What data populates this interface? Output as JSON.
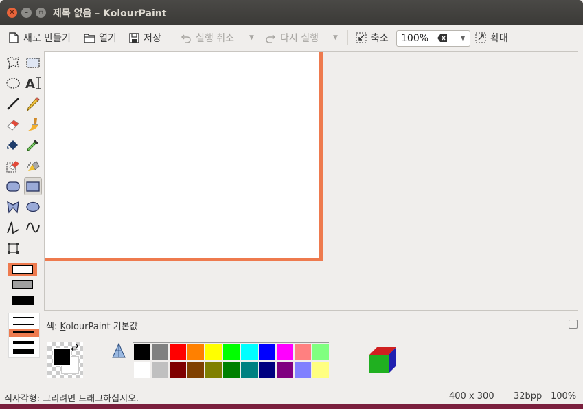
{
  "window": {
    "title": "제목 없음 – KolourPaint",
    "buttons": [
      "close",
      "minimize",
      "maximize"
    ]
  },
  "toolbar": {
    "new_label": "새로 만들기",
    "open_label": "열기",
    "save_label": "저장",
    "undo_label": "실행 취소",
    "redo_label": "다시 실행",
    "zoom_out_label": "축소",
    "zoom_value": "100%",
    "zoom_in_label": "확대"
  },
  "tools": [
    "free-form-selection-icon",
    "rectangular-selection-icon",
    "elliptical-selection-icon",
    "text-icon",
    "line-icon",
    "pen-icon",
    "eraser-icon",
    "brush-icon",
    "flood-fill-icon",
    "color-picker-icon",
    "color-eraser-icon",
    "spraycan-icon",
    "rounded-rectangle-icon",
    "rectangle-icon",
    "polygon-icon",
    "ellipse-icon",
    "connected-lines-icon",
    "curve-icon",
    "resize-canvas-icon"
  ],
  "selected_tool": "rectangle-icon",
  "canvas": {
    "size_text": "400 x 300",
    "border_color": "#ee7a4e"
  },
  "color_box": {
    "label_prefix": "색: ",
    "label_underlined": "K",
    "label_rest": "olourPaint 기본값",
    "foreground": "#000000",
    "background": "#ffffff",
    "palette_row1": [
      "#000000",
      "#808080",
      "#ff0000",
      "#ff8000",
      "#ffff00",
      "#00ff00",
      "#00ffff",
      "#0000ff",
      "#ff00ff",
      "#ff8080",
      "#80ff80"
    ],
    "palette_row2": [
      "#ffffff",
      "#c0c0c0",
      "#800000",
      "#804000",
      "#808000",
      "#008000",
      "#008080",
      "#000080",
      "#800080",
      "#8080ff",
      "#ffff80"
    ]
  },
  "status": {
    "message": "직사각형: 그리려면 드래그하십시오.",
    "size": "400 x 300",
    "bpp": "32bpp",
    "zoom": "100%"
  }
}
